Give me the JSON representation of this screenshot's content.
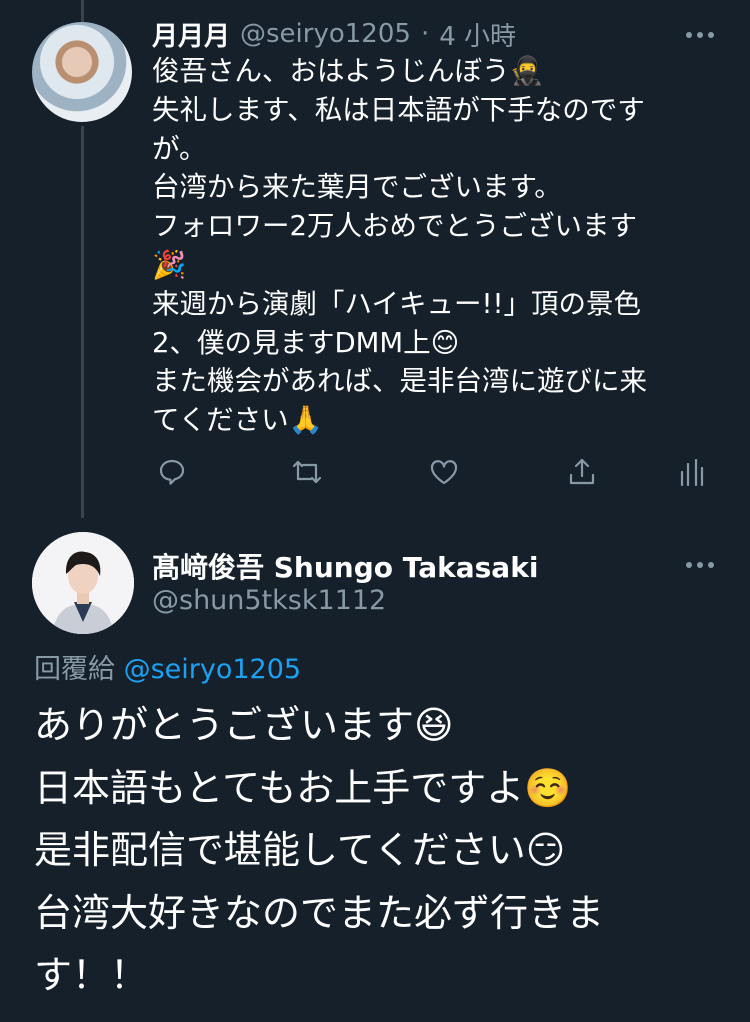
{
  "tweet": {
    "display_name": "月月月",
    "handle": "@seiryo1205",
    "separator": "·",
    "time": "4 小時",
    "lines": [
      "俊吾さん、おはようじんぼう🥷",
      "失礼します、私は日本語が下手なのです",
      "が。",
      "台湾から来た葉月でございます。",
      "フォロワー2万人おめでとうございます",
      "🎉",
      "来週から演劇「ハイキュー!!」頂の景色",
      "2、僕の見ますDMM上😊",
      "また機会があれば、是非台湾に遊びに来",
      "てください🙏"
    ],
    "actions": [
      "reply-icon",
      "retweet-icon",
      "like-icon",
      "share-icon",
      "analytics-icon"
    ]
  },
  "reply": {
    "display_name": "髙﨑俊吾 Shungo Takasaki",
    "handle": "@shun5tksk1112",
    "reply_label": "回覆給",
    "reply_to_handle": "@seiryo1205",
    "lines": [
      "ありがとうございます😆",
      "日本語もとてもお上手ですよ☺️",
      "是非配信で堪能してください😏",
      "台湾大好きなのでまた必ず行きま",
      "す！！"
    ]
  },
  "colors": {
    "background": "#15202b",
    "secondary_text": "#8899a6",
    "link": "#1da1f2",
    "thread_line": "#38444d"
  }
}
